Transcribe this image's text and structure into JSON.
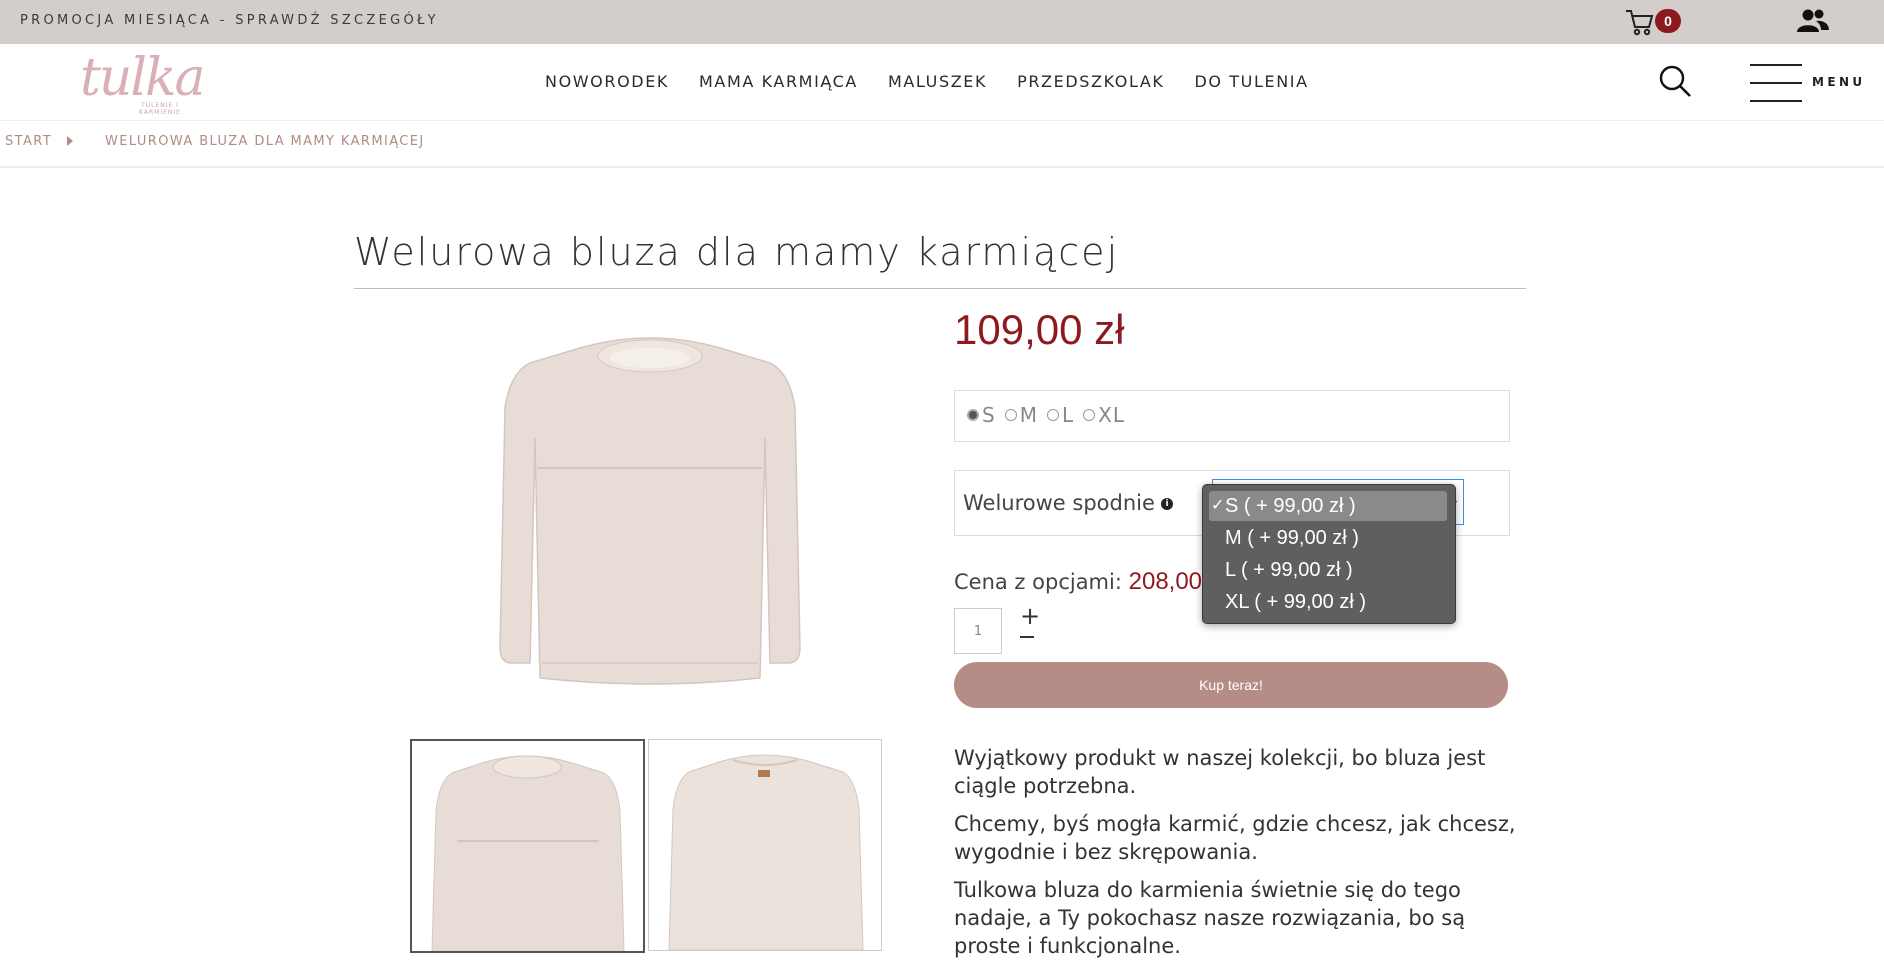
{
  "promo_bar": {
    "text": "PROMOCJA MIESIĄCA - SPRAWDŹ SZCZEGÓŁY"
  },
  "cart": {
    "count": "0"
  },
  "logo": {
    "text": "tulka",
    "tagline": "TULENIE I KARMIENIE"
  },
  "nav": {
    "items": [
      "NOWORODEK",
      "MAMA KARMIĄCA",
      "MALUSZEK",
      "PRZEDSZKOLAK",
      "DO TULENIA"
    ]
  },
  "menu": {
    "label": "MENU"
  },
  "breadcrumb": {
    "start": "START",
    "current": "WELUROWA BLUZA DLA MAMY KARMIĄCEJ"
  },
  "product": {
    "title": "Welurowa bluza dla mamy karmiącej",
    "price": "109,00 zł",
    "sizes": [
      "S",
      "M",
      "L",
      "XL"
    ],
    "selected_size": "S",
    "pants_label": "Welurowe spodnie",
    "pants_options": [
      "S ( + 99,00 zł )",
      "M ( + 99,00 zł )",
      "L ( + 99,00 zł )",
      "XL ( + 99,00 zł )"
    ],
    "pants_selected": "S ( + 99,00 zł )",
    "options_price_label": "Cena z opcjami:",
    "options_price_value": "208,00",
    "quantity": "1",
    "buy_label": "Kup teraz!",
    "description": [
      "Wyjątkowy produkt w naszej kolekcji, bo bluza jest ciągle potrzebna.",
      "Chcemy, byś mogła karmić, gdzie chcesz, jak chcesz, wygodnie i bez skrępowania.",
      "Tulkowa bluza do karmienia świetnie się do tego nadaje, a Ty pokochasz nasze rozwiązania, bo są proste i funkcjonalne."
    ]
  },
  "colors": {
    "brand_red": "#8c1a1f",
    "buy_button": "#b58c86",
    "promo_bar": "#d3ceca",
    "accent_pink": "#b08c84"
  }
}
